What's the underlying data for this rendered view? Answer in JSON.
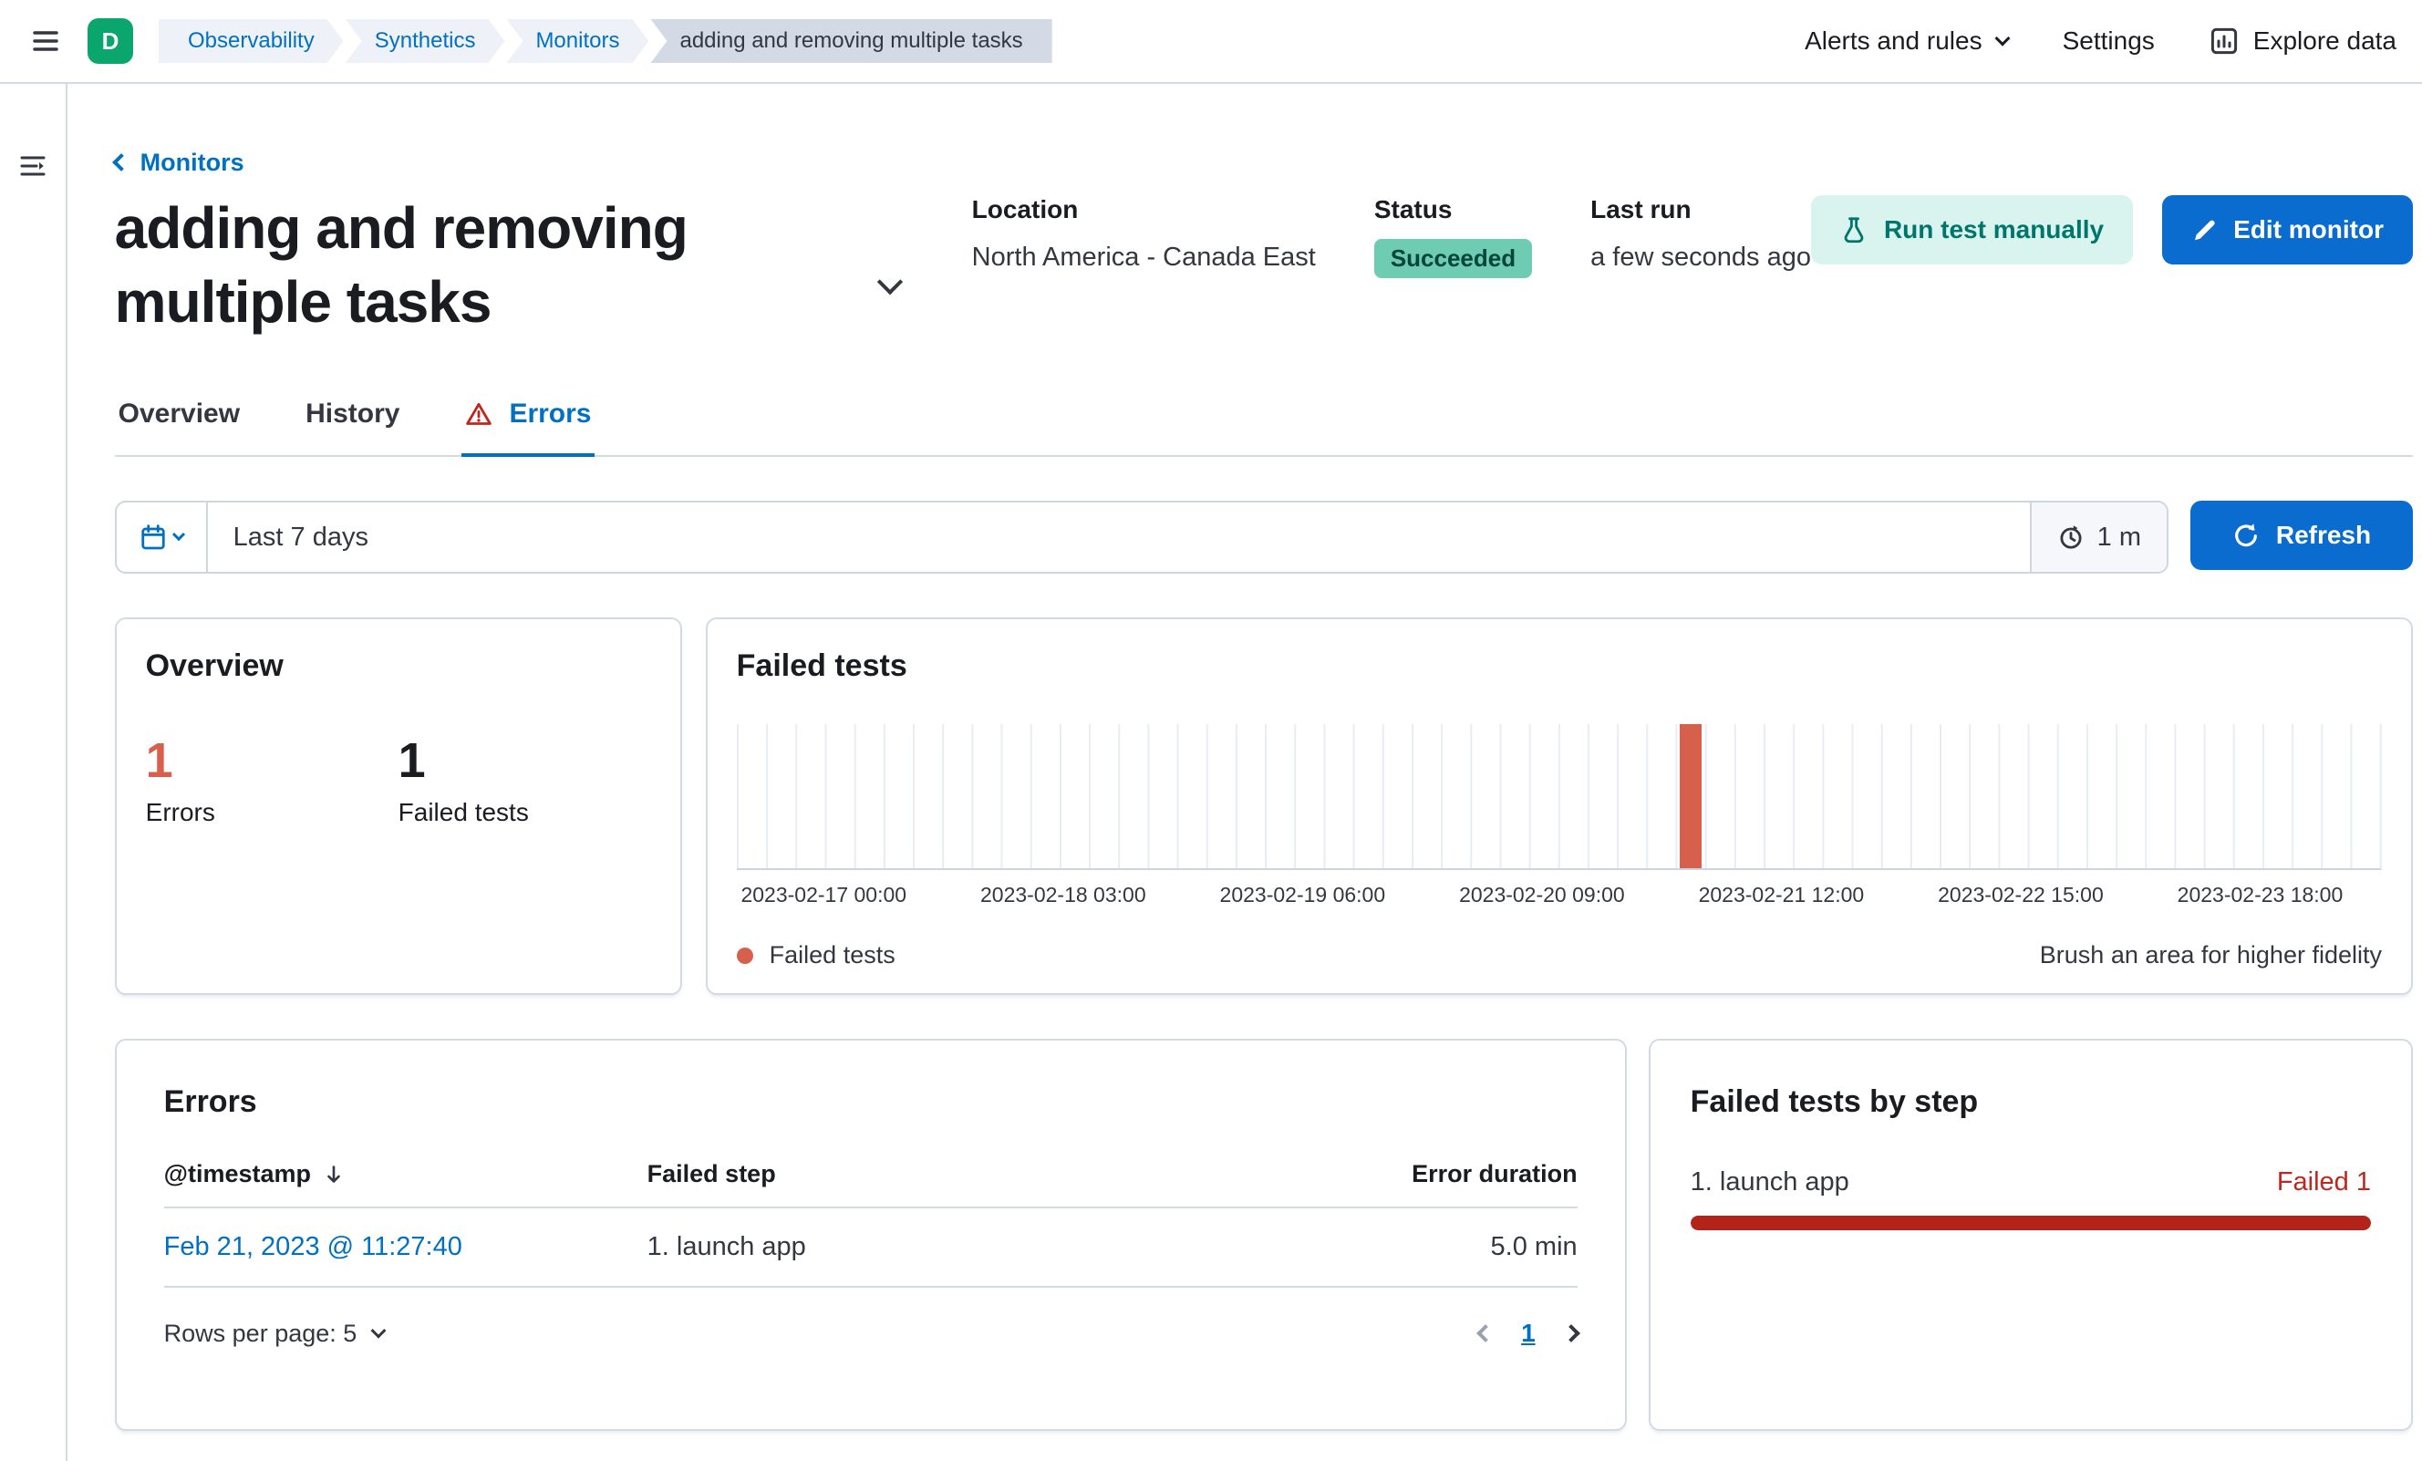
{
  "colors": {
    "primary_button": "#0a6ccf",
    "link": "#0071c2",
    "success_badge_bg": "#6dccb1",
    "run_test_bg": "#d9f3ef",
    "run_test_text": "#00756b",
    "errors_stat": "#d6604c",
    "failed_bar": "#d6604c",
    "danger_text": "#bd271e",
    "step_bar_fill": "#b3231a",
    "space_avatar_bg": "#0aa66e"
  },
  "icon_names": [
    "menu-icon",
    "menu-open-icon",
    "chevron-down-icon",
    "chevron-left-icon",
    "explore-data-icon",
    "calendar-icon",
    "timer-icon",
    "refresh-icon",
    "warning-icon",
    "flask-icon",
    "pencil-icon",
    "sort-descending-icon",
    "previous-page-icon",
    "next-page-icon",
    "failed-tests-dot-icon"
  ],
  "header": {
    "space_initial": "D",
    "breadcrumbs": [
      "Observability",
      "Synthetics",
      "Monitors",
      "adding and removing multiple tasks"
    ],
    "nav": {
      "alerts_label": "Alerts and rules",
      "settings_label": "Settings",
      "explore_label": "Explore data"
    }
  },
  "page": {
    "back_link": "Monitors",
    "title": "adding and removing multiple tasks",
    "meta": {
      "location_label": "Location",
      "location_value": "North America - Canada East",
      "status_label": "Status",
      "status_value": "Succeeded",
      "last_run_label": "Last run",
      "last_run_value": "a few seconds ago"
    },
    "run_test_label": "Run test manually",
    "edit_label": "Edit monitor"
  },
  "tabs": [
    {
      "label": "Overview"
    },
    {
      "label": "History"
    },
    {
      "label": "Errors",
      "active": true
    }
  ],
  "datepicker": {
    "range_label": "Last 7 days",
    "interval_label": "1 m",
    "refresh_label": "Refresh"
  },
  "overview_panel": {
    "title": "Overview",
    "stats": [
      {
        "value": "1",
        "label": "Errors"
      },
      {
        "value": "1",
        "label": "Failed tests"
      }
    ]
  },
  "failed_tests_panel": {
    "hint": "Brush an area for higher fidelity"
  },
  "chart_data": {
    "type": "bar",
    "title": "Failed tests",
    "x_ticks": [
      "2023-02-17 00:00",
      "2023-02-18 03:00",
      "2023-02-19 06:00",
      "2023-02-20 09:00",
      "2023-02-21 12:00",
      "2023-02-22 15:00",
      "2023-02-23 18:00"
    ],
    "series": [
      {
        "name": "Failed tests",
        "color": "#d6604c",
        "points": [
          {
            "x": "2023-02-21 06:00",
            "y": 1
          }
        ]
      }
    ],
    "ylim": [
      0,
      1
    ],
    "grid": true,
    "bucket_count": 56,
    "failed_bucket_index": 32,
    "first_tick_fraction": 0.053,
    "tick_step_fraction": 0.1455,
    "legend_position": "bottom-left"
  },
  "errors_panel": {
    "title": "Errors",
    "columns": {
      "timestamp": "@timestamp",
      "failed_step": "Failed step",
      "error_duration": "Error duration"
    },
    "rows": [
      {
        "timestamp": "Feb 21, 2023 @ 11:27:40",
        "failed_step": "1. launch app",
        "error_duration": "5.0 min"
      }
    ],
    "rows_per_page_label": "Rows per page: 5",
    "current_page": "1"
  },
  "failed_steps_panel": {
    "title": "Failed tests by step",
    "steps": [
      {
        "name": "1. launch app",
        "result": "Failed 1",
        "fraction": 1
      }
    ]
  }
}
